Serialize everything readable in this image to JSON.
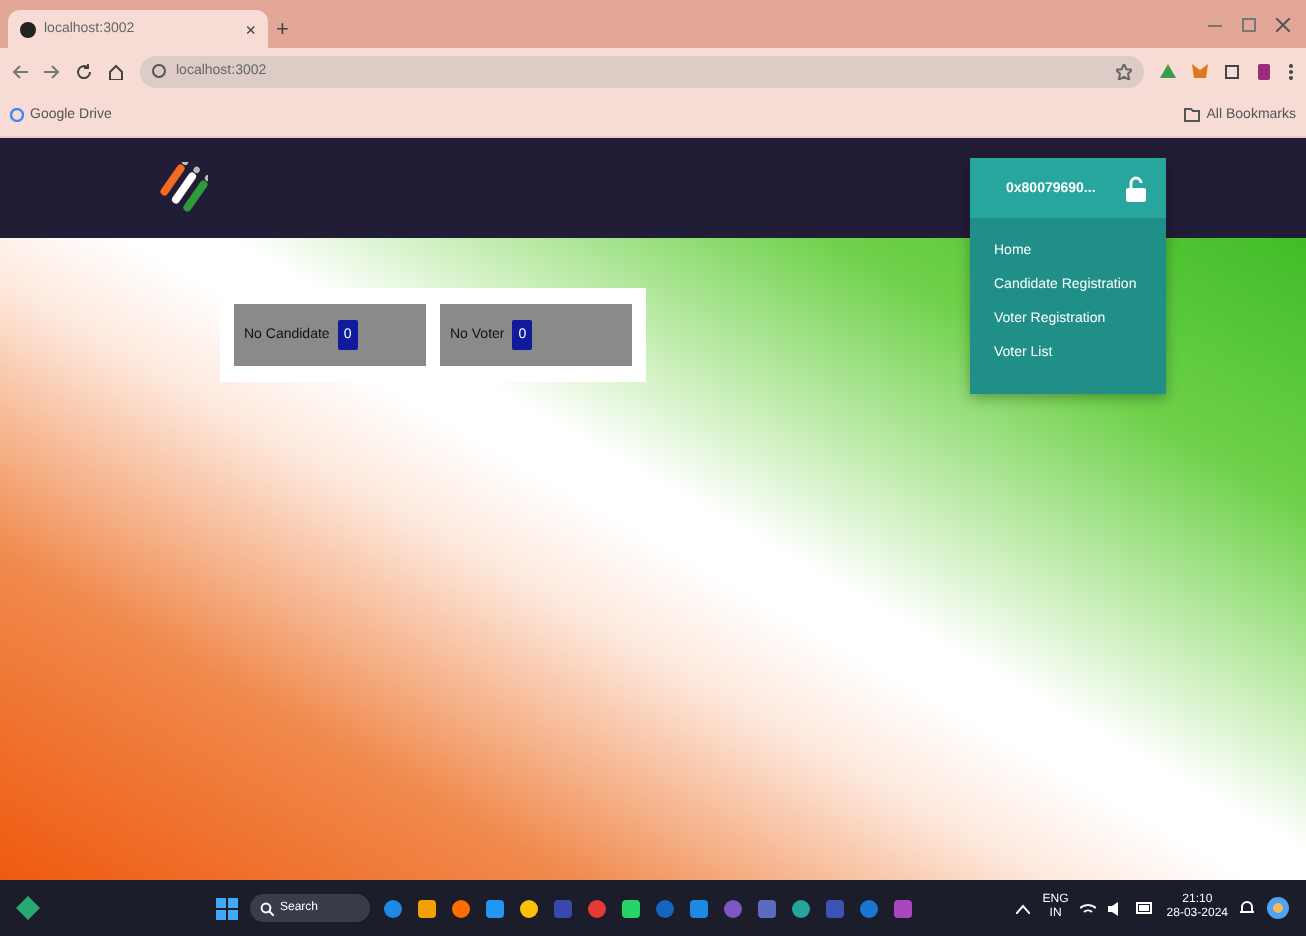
{
  "browser": {
    "tab": {
      "title": "localhost:3002",
      "close": "×"
    },
    "new_tab": "+",
    "url": "localhost:3002",
    "bookmarks": [
      {
        "label": "Google Drive"
      }
    ],
    "all_bookmarks": "All Bookmarks"
  },
  "navbar": {
    "account": "0x80079690...",
    "locked": false
  },
  "menu": [
    {
      "label": "Home"
    },
    {
      "label": "Candidate Registration"
    },
    {
      "label": "Voter Registration"
    },
    {
      "label": "Voter List"
    }
  ],
  "stats": [
    {
      "label": "No Candidate",
      "value": "0"
    },
    {
      "label": "No Voter",
      "value": "0"
    }
  ],
  "taskbar": {
    "search": "Search",
    "language": "ENG",
    "region": "IN",
    "time": "21:10",
    "date": "28-03-2024"
  }
}
